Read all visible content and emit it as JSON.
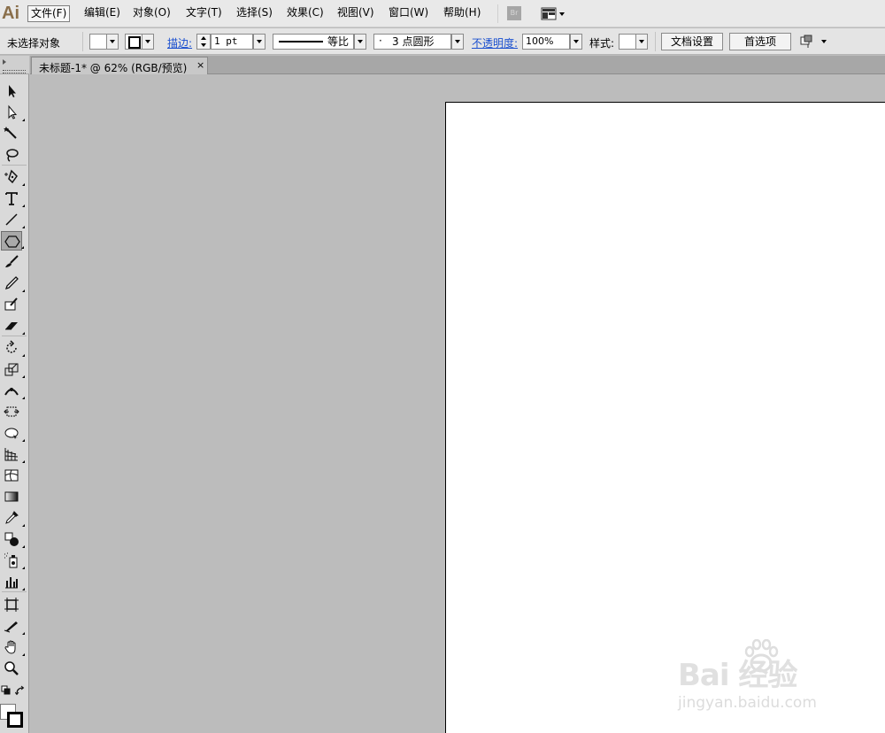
{
  "app": {
    "logo": "Ai",
    "bridge_label": "Br"
  },
  "menu": [
    {
      "label": "文件(F)"
    },
    {
      "label": "编辑(E)"
    },
    {
      "label": "对象(O)"
    },
    {
      "label": "文字(T)"
    },
    {
      "label": "选择(S)"
    },
    {
      "label": "效果(C)"
    },
    {
      "label": "视图(V)"
    },
    {
      "label": "窗口(W)"
    },
    {
      "label": "帮助(H)"
    }
  ],
  "control": {
    "selection_status": "未选择对象",
    "stroke_label": "描边:",
    "stroke_weight": "1 pt",
    "stroke_profile": "等比",
    "brush_value": "3 点圆形",
    "opacity_label": "不透明度:",
    "opacity_value": "100%",
    "style_label": "样式:",
    "doc_setup_label": "文档设置",
    "preferences_label": "首选项"
  },
  "document": {
    "tab_title": "未标题-1* @ 62% (RGB/预览)",
    "close_glyph": "×"
  },
  "watermark": {
    "brand": "Bai 经验",
    "url": "jingyan.baidu.com"
  },
  "colors": {
    "menubar_bg": "#e9e9e9",
    "canvas_bg": "#bcbcbc",
    "link_blue": "#1a4fcf",
    "logo_brown": "#8a6f4b"
  }
}
